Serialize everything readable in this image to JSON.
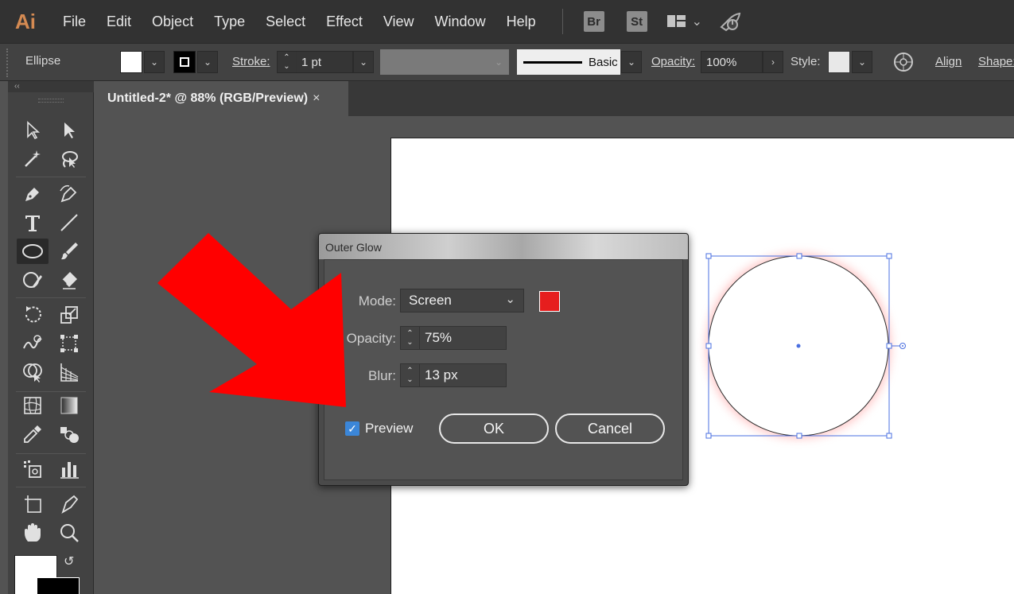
{
  "app": {
    "logo": "Ai",
    "menu": [
      "File",
      "Edit",
      "Object",
      "Type",
      "Select",
      "Effect",
      "View",
      "Window",
      "Help"
    ],
    "bridge_badge": "Br",
    "stock_badge": "St"
  },
  "controlbar": {
    "tool_name": "Ellipse",
    "stroke_label": "Stroke:",
    "stroke_value": "1 pt",
    "brush_label": "Basic",
    "opacity_label": "Opacity:",
    "opacity_value": "100%",
    "style_label": "Style:",
    "align_label": "Align",
    "shape_label": "Shape:"
  },
  "toolpanel": {
    "collapse_label": "‹‹"
  },
  "document": {
    "tab_title": "Untitled-2* @ 88% (RGB/Preview)",
    "close_glyph": "×"
  },
  "dialog": {
    "title": "Outer Glow",
    "mode_label": "Mode:",
    "mode_value": "Screen",
    "opacity_label": "Opacity:",
    "opacity_value": "75%",
    "blur_label": "Blur:",
    "blur_value": "13 px",
    "preview_label": "Preview",
    "preview_checked": true,
    "ok_label": "OK",
    "cancel_label": "Cancel",
    "glow_color": "#e61e1e"
  },
  "colors": {
    "annotation_arrow": "#ff0000",
    "selection": "#4a6fe0",
    "glow": "#ff9a9a"
  }
}
